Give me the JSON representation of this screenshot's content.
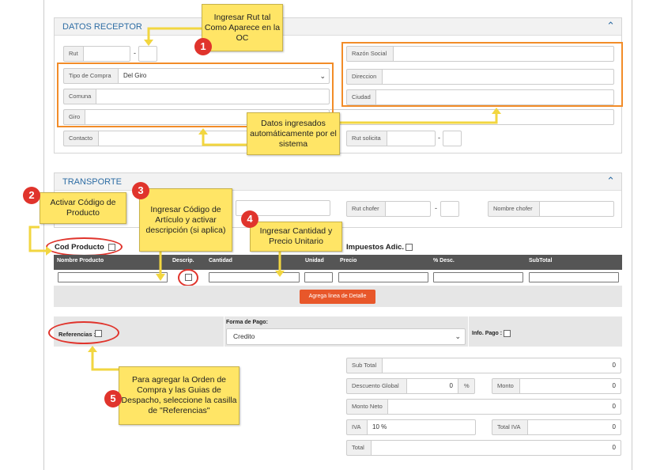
{
  "receptor": {
    "title": "DATOS RECEPTOR",
    "rut_label": "Rut",
    "rut_value": "",
    "rut_dv": "",
    "tipo_compra_label": "Tipo de Compra",
    "tipo_compra_value": "Del Giro",
    "comuna_label": "Comuna",
    "giro_label": "Giro",
    "contacto_label": "Contacto",
    "razon_social_label": "Razón Social",
    "direccion_label": "Direccion",
    "ciudad_label": "Ciudad",
    "rut_solicita_label": "Rut solicita"
  },
  "transporte": {
    "title": "TRANSPORTE",
    "rut_chofer_label": "Rut chofer",
    "nombre_chofer_label": "Nombre chofer"
  },
  "detalle": {
    "cod_producto_label": "Cod Producto",
    "impuestos_label": "Impuestos Adic.",
    "columns": [
      "Nombre Producto",
      "Descrip.",
      "Cantidad",
      "Unidad",
      "Precio",
      "% Desc.",
      "SubTotal"
    ],
    "add_button": "Agrega linea de Detalle"
  },
  "pago": {
    "referencias_label": "Referencias :",
    "forma_pago_label": "Forma de Pago:",
    "forma_pago_value": "Credito",
    "info_pago_label": "Info. Pago :"
  },
  "totales": {
    "sub_total_label": "Sub Total",
    "sub_total_value": "0",
    "descuento_label": "Descuento Global",
    "descuento_value": "0",
    "descuento_unit": "%",
    "monto_label": "Monto",
    "monto_value": "0",
    "monto_neto_label": "Monto Neto",
    "monto_neto_value": "0",
    "iva_label": "IVA",
    "iva_value": "10 %",
    "total_iva_label": "Total IVA",
    "total_iva_value": "0",
    "total_label": "Total",
    "total_value": "0"
  },
  "annotations": {
    "n1": "1",
    "note1": "Ingresar Rut tal Como Aparece en la OC",
    "n2": "2",
    "note2": "Activar Código de Producto",
    "n3": "3",
    "note3": "Ingresar Código de Artículo y activar descripción (si aplica)",
    "n4": "4",
    "note4": "Ingresar Cantidad y Precio Unitario",
    "n5": "5",
    "note5": "Para agregar la Orden de Compra y las Guias de Despacho, seleccione la casilla de \"Referencias\"",
    "note_auto": "Datos ingresados automáticamente por el sistema"
  },
  "colors": {
    "accent_blue": "#2e6da4",
    "table_header": "#555555",
    "orange_highlight": "#f28c28",
    "note_yellow": "#ffe566",
    "badge_red": "#e0342c",
    "button_orange": "#e8572a"
  }
}
